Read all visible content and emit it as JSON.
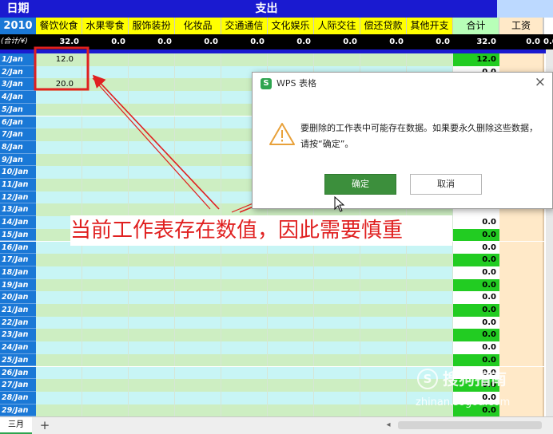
{
  "sheet": {
    "corner_label": "日期",
    "section_label": "支出",
    "year": "2010",
    "total_row_label": "(合计/¥)",
    "columns": [
      {
        "label": "餐饮伙食",
        "total": "32.0"
      },
      {
        "label": "水果零食",
        "total": "0.0"
      },
      {
        "label": "服饰装扮",
        "total": "0.0"
      },
      {
        "label": "化妆品",
        "total": "0.0"
      },
      {
        "label": "交通通信",
        "total": "0.0"
      },
      {
        "label": "文化娱乐",
        "total": "0.0"
      },
      {
        "label": "人际交往",
        "total": "0.0"
      },
      {
        "label": "偿还贷款",
        "total": "0.0"
      },
      {
        "label": "其他开支",
        "total": "0.0"
      },
      {
        "label": "合计",
        "total": "32.0"
      },
      {
        "label": "工资",
        "total": "0.0"
      },
      {
        "label": "",
        "total": "0.0"
      }
    ],
    "rows": [
      {
        "date": "1/Jan",
        "food": "12.0",
        "sum": "12.0"
      },
      {
        "date": "2/Jan",
        "food": "",
        "sum": "0.0"
      },
      {
        "date": "3/Jan",
        "food": "20.0",
        "sum": ""
      },
      {
        "date": "4/Jan",
        "food": "",
        "sum": ""
      },
      {
        "date": "5/Jan",
        "food": "",
        "sum": ""
      },
      {
        "date": "6/Jan",
        "food": "",
        "sum": ""
      },
      {
        "date": "7/Jan",
        "food": "",
        "sum": ""
      },
      {
        "date": "8/Jan",
        "food": "",
        "sum": ""
      },
      {
        "date": "9/Jan",
        "food": "",
        "sum": ""
      },
      {
        "date": "10/Jan",
        "food": "",
        "sum": ""
      },
      {
        "date": "11/Jan",
        "food": "",
        "sum": ""
      },
      {
        "date": "12/Jan",
        "food": "",
        "sum": ""
      },
      {
        "date": "13/Jan",
        "food": "",
        "sum": ""
      },
      {
        "date": "14/Jan",
        "food": "",
        "sum": "0.0"
      },
      {
        "date": "15/Jan",
        "food": "",
        "sum": "0.0"
      },
      {
        "date": "16/Jan",
        "food": "",
        "sum": "0.0"
      },
      {
        "date": "17/Jan",
        "food": "",
        "sum": "0.0"
      },
      {
        "date": "18/Jan",
        "food": "",
        "sum": "0.0"
      },
      {
        "date": "19/Jan",
        "food": "",
        "sum": "0.0"
      },
      {
        "date": "20/Jan",
        "food": "",
        "sum": "0.0"
      },
      {
        "date": "21/Jan",
        "food": "",
        "sum": "0.0"
      },
      {
        "date": "22/Jan",
        "food": "",
        "sum": "0.0"
      },
      {
        "date": "23/Jan",
        "food": "",
        "sum": "0.0"
      },
      {
        "date": "24/Jan",
        "food": "",
        "sum": "0.0"
      },
      {
        "date": "25/Jan",
        "food": "",
        "sum": "0.0"
      },
      {
        "date": "26/Jan",
        "food": "",
        "sum": "0.0"
      },
      {
        "date": "27/Jan",
        "food": "",
        "sum": "0.0"
      },
      {
        "date": "28/Jan",
        "food": "",
        "sum": "0.0"
      },
      {
        "date": "29/Jan",
        "food": "",
        "sum": "0.0"
      }
    ]
  },
  "dialog": {
    "title": "WPS 表格",
    "app_badge": "S",
    "message": "要删除的工作表中可能存在数据。如果要永久删除这些数据，请按“确定”。",
    "ok_label": "确定",
    "cancel_label": "取消",
    "close_glyph": "×"
  },
  "annotation": {
    "text": "当前工作表存在数值，因此需要慎重"
  },
  "tabs": {
    "active_sheet": "三月",
    "add_glyph": "+",
    "scroll_left_glyph": "◂"
  },
  "watermark": {
    "brand": "搜狗指南",
    "url": "zhinan.sogou.com"
  },
  "colors": {
    "header_blue": "#1a1ad0",
    "header_yellow": "#ffff00",
    "date_blue": "#1a78d6",
    "row_cyan": "#c8f5f5",
    "row_green": "#cdeec2",
    "sum_green": "#22cc22",
    "annotation_red": "#e02020",
    "ok_green": "#3c8f3c"
  }
}
